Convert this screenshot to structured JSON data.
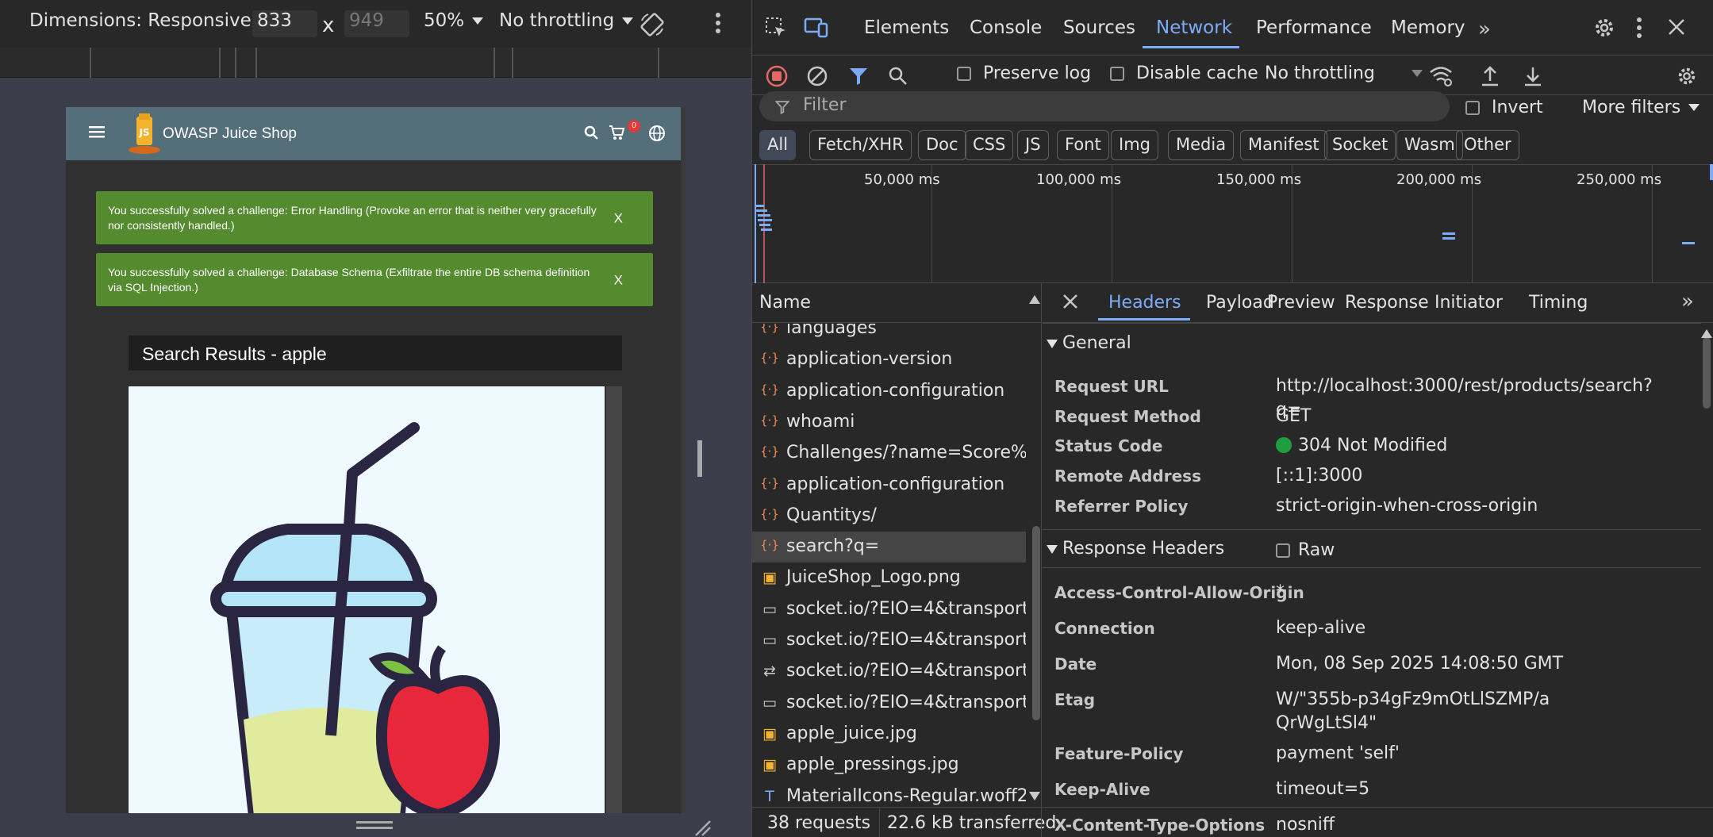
{
  "emulation": {
    "dimensions_label": "Dimensions: Responsive",
    "width": "833",
    "times": "x",
    "height": "949",
    "zoom": "50%",
    "throttling": "No throttling"
  },
  "app": {
    "title": "OWASP Juice Shop",
    "cart_badge": "0",
    "toasts": [
      {
        "text": "You successfully solved a challenge: Error Handling (Provoke an error that is neither very gracefully nor consistently handled.)",
        "close": "X"
      },
      {
        "text": "You successfully solved a challenge: Database Schema (Exfiltrate the entire DB schema definition via SQL Injection.)",
        "close": "X"
      }
    ],
    "search_title": "Search Results - apple"
  },
  "devtools": {
    "tabs": [
      "Elements",
      "Console",
      "Sources",
      "Network",
      "Performance",
      "Memory"
    ],
    "active_tab": "Network",
    "toolbar": {
      "preserve_log": "Preserve log",
      "disable_cache": "Disable cache",
      "throttling": "No throttling"
    },
    "filter": {
      "placeholder": "Filter",
      "invert": "Invert",
      "more_filters": "More filters"
    },
    "type_filters": [
      "All",
      "Fetch/XHR",
      "Doc",
      "CSS",
      "JS",
      "Font",
      "Img",
      "Media",
      "Manifest",
      "Socket",
      "Wasm",
      "Other"
    ],
    "overview_ticks": [
      "50,000 ms",
      "100,000 ms",
      "150,000 ms",
      "200,000 ms",
      "250,000 ms"
    ],
    "request_list": {
      "header": "Name",
      "items": [
        {
          "name": "languages",
          "icon": "fetch-icon"
        },
        {
          "name": "application-version",
          "icon": "fetch-icon"
        },
        {
          "name": "application-configuration",
          "icon": "fetch-icon"
        },
        {
          "name": "whoami",
          "icon": "fetch-icon"
        },
        {
          "name": "Challenges/?name=Score%...",
          "icon": "fetch-icon"
        },
        {
          "name": "application-configuration",
          "icon": "fetch-icon"
        },
        {
          "name": "Quantitys/",
          "icon": "fetch-icon"
        },
        {
          "name": "search?q=",
          "icon": "fetch-icon",
          "selected": true
        },
        {
          "name": "JuiceShop_Logo.png",
          "icon": "image-icon"
        },
        {
          "name": "socket.io/?EIO=4&transport...",
          "icon": "document-icon"
        },
        {
          "name": "socket.io/?EIO=4&transport...",
          "icon": "document-icon"
        },
        {
          "name": "socket.io/?EIO=4&transport...",
          "icon": "websocket-icon"
        },
        {
          "name": "socket.io/?EIO=4&transport...",
          "icon": "document-icon"
        },
        {
          "name": "apple_juice.jpg",
          "icon": "image-icon"
        },
        {
          "name": "apple_pressings.jpg",
          "icon": "image-icon"
        },
        {
          "name": "MaterialIcons-Regular.woff2",
          "icon": "font-icon"
        }
      ]
    },
    "status": {
      "requests": "38 requests",
      "transferred": "22.6 kB transferred"
    },
    "details": {
      "tabs": [
        "Headers",
        "Payload",
        "Preview",
        "Response",
        "Initiator",
        "Timing"
      ],
      "active_tab": "Headers",
      "general_title": "General",
      "general": [
        {
          "k": "Request URL",
          "v": "http://localhost:3000/rest/products/search?q="
        },
        {
          "k": "Request Method",
          "v": "GET"
        },
        {
          "k": "Status Code",
          "v": "304 Not Modified"
        },
        {
          "k": "Remote Address",
          "v": "[::1]:3000"
        },
        {
          "k": "Referrer Policy",
          "v": "strict-origin-when-cross-origin"
        }
      ],
      "response_title": "Response Headers",
      "raw_label": "Raw",
      "response": [
        {
          "k": "Access-Control-Allow-Origin",
          "v": "*"
        },
        {
          "k": "Connection",
          "v": "keep-alive"
        },
        {
          "k": "Date",
          "v": "Mon, 08 Sep 2025 14:08:50 GMT"
        },
        {
          "k": "Etag",
          "v": "W/\"355b-p34gFz9mOtLlSZMP/aQrWgLtSl4\""
        },
        {
          "k": "Feature-Policy",
          "v": "payment 'self'"
        },
        {
          "k": "Keep-Alive",
          "v": "timeout=5"
        },
        {
          "k": "X-Content-Type-Options",
          "v": "nosniff"
        }
      ]
    },
    "colors": {
      "accent": "#7cacf8",
      "status_ok": "#1e9e3e",
      "toast": "#558b2f",
      "record": "#e46962"
    }
  }
}
